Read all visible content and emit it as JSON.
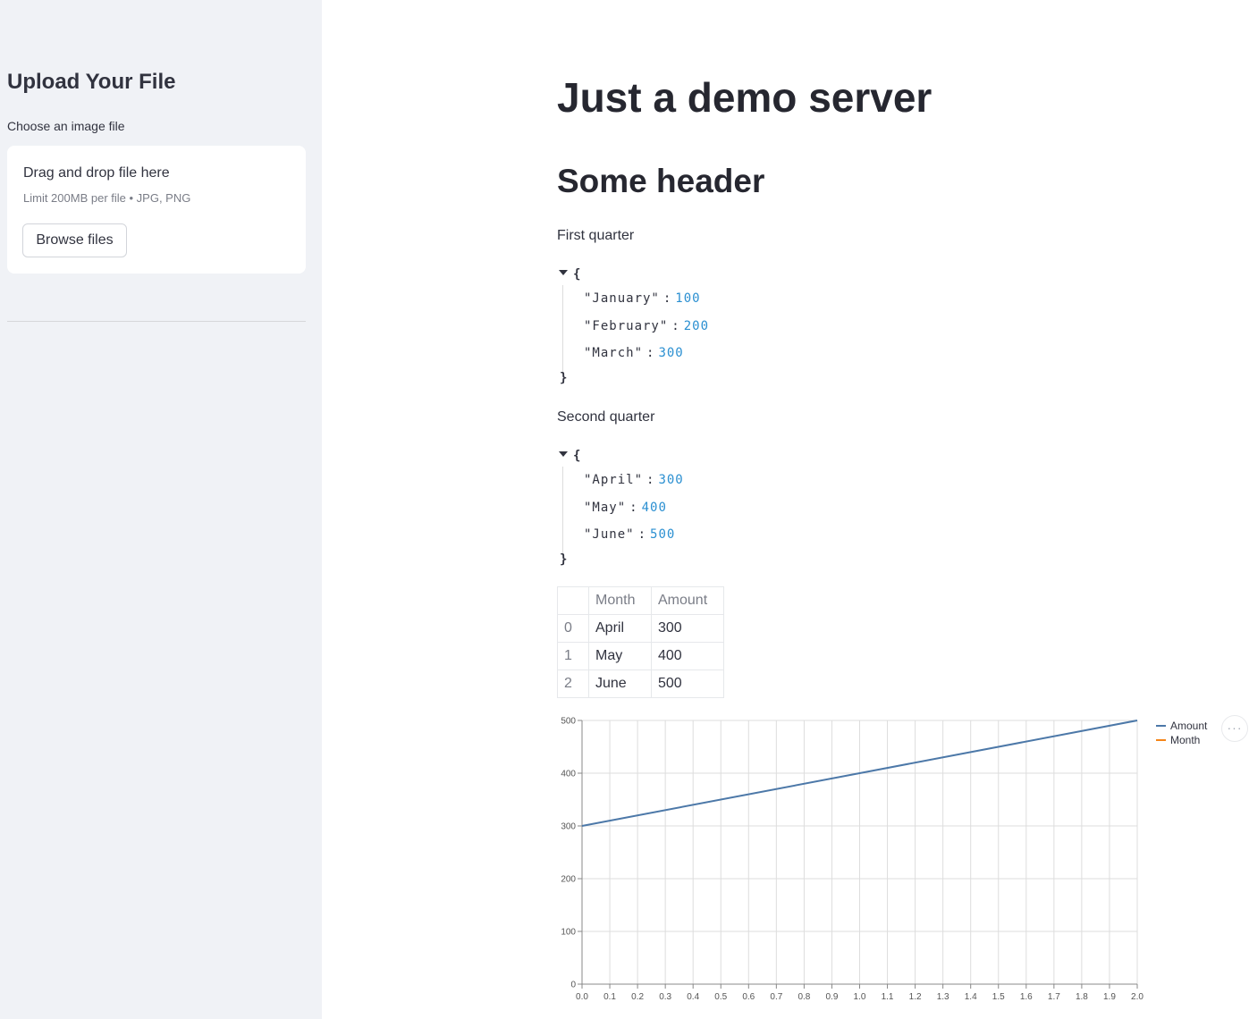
{
  "sidebar": {
    "title": "Upload Your File",
    "uploader_label": "Choose an image file",
    "dropzone": {
      "title": "Drag and drop file here",
      "limit": "Limit 200MB per file • JPG, PNG",
      "browse_label": "Browse files"
    }
  },
  "main": {
    "title": "Just a demo server",
    "header": "Some header",
    "q1": {
      "caption": "First quarter",
      "entries": [
        {
          "key": "\"January\"",
          "value": "100"
        },
        {
          "key": "\"February\"",
          "value": "200"
        },
        {
          "key": "\"March\"",
          "value": "300"
        }
      ]
    },
    "q2": {
      "caption": "Second quarter",
      "entries": [
        {
          "key": "\"April\"",
          "value": "300"
        },
        {
          "key": "\"May\"",
          "value": "400"
        },
        {
          "key": "\"June\"",
          "value": "500"
        }
      ]
    },
    "json_open": "{",
    "json_close": "}",
    "json_colon": ":",
    "table": {
      "columns": [
        "",
        "Month",
        "Amount"
      ],
      "rows": [
        [
          "0",
          "April",
          "300"
        ],
        [
          "1",
          "May",
          "400"
        ],
        [
          "2",
          "June",
          "500"
        ]
      ]
    },
    "menu_icon": "···"
  },
  "chart_data": {
    "type": "line",
    "x": [
      0,
      1,
      2
    ],
    "series": [
      {
        "name": "Amount",
        "values": [
          300,
          400,
          500
        ],
        "color": "#4c78a8"
      },
      {
        "name": "Month",
        "values": [],
        "color": "#f58518"
      }
    ],
    "xlim": [
      0,
      2
    ],
    "ylim": [
      0,
      500
    ],
    "x_ticks": [
      "0.0",
      "0.1",
      "0.2",
      "0.3",
      "0.4",
      "0.5",
      "0.6",
      "0.7",
      "0.8",
      "0.9",
      "1.0",
      "1.1",
      "1.2",
      "1.3",
      "1.4",
      "1.5",
      "1.6",
      "1.7",
      "1.8",
      "1.9",
      "2.0"
    ],
    "y_ticks": [
      "0",
      "100",
      "200",
      "300",
      "400",
      "500"
    ],
    "grid": true,
    "legend_position": "top-right"
  }
}
